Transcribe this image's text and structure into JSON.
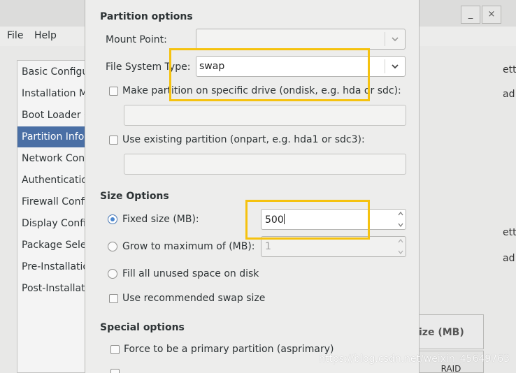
{
  "background_window": {
    "menu": [
      "File",
      "Help"
    ],
    "window_controls": [
      "_",
      "×"
    ],
    "sidebar_items": [
      "Basic Configu",
      "Installation M",
      "Boot Loader O",
      "Partition Infor",
      "Network Conf",
      "Authenticatio",
      "Firewall Confi",
      "Display Config",
      "Package Selec",
      "Pre-Installatio",
      "Post-Installati"
    ],
    "right_fragments": [
      "ett",
      "ad",
      "ett",
      "ad"
    ],
    "right_panel_label": "ize (MB)",
    "raid_label": "RAID"
  },
  "dialog": {
    "partition_options": {
      "title": "Partition options",
      "mount_point_label": "Mount Point:",
      "mount_point_value": "",
      "fs_type_label": "File System Type:",
      "fs_type_value": "swap",
      "specific_drive_label": "Make partition on specific drive (ondisk, e.g. hda or sdc):",
      "specific_drive_value": "",
      "existing_partition_label": "Use existing partition (onpart, e.g. hda1 or sdc3):",
      "existing_partition_value": ""
    },
    "size_options": {
      "title": "Size Options",
      "fixed_size_label": "Fixed size (MB):",
      "fixed_size_value": "500",
      "grow_label": "Grow to maximum of (MB):",
      "grow_value": "1",
      "fill_label": "Fill all unused space on disk",
      "recommended_swap_label": "Use recommended swap size"
    },
    "special_options": {
      "title": "Special options",
      "primary_label": "Force to be a primary partition (asprimary)"
    }
  },
  "watermark": "https://blog.csdn.net/weixin_45649763",
  "colors": {
    "highlight": "#f5c20f",
    "selection": "#4a6fa5"
  }
}
